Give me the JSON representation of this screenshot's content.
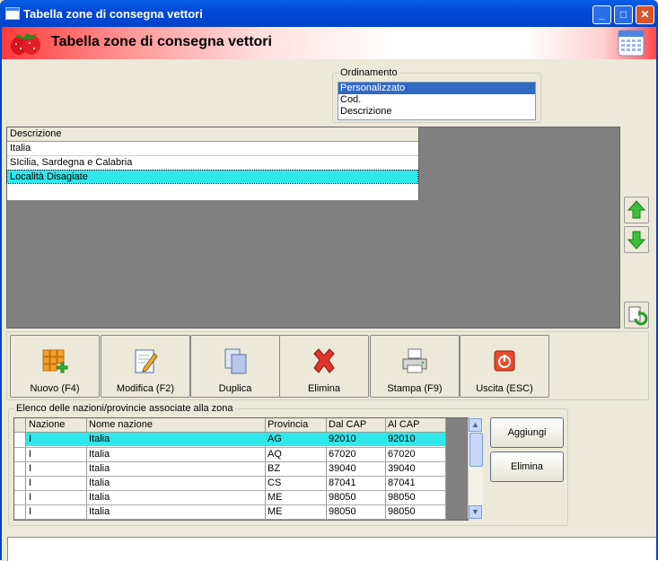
{
  "window": {
    "title": "Tabella zone di consegna vettori",
    "min": "_",
    "max": "□",
    "close": "✕"
  },
  "header": {
    "title": "Tabella zone di consegna vettori"
  },
  "ordinamento": {
    "label": "Ordinamento",
    "options": [
      "Personalizzato",
      "Cod.",
      "Descrizione"
    ],
    "selected": "Personalizzato"
  },
  "zones": {
    "column": "Descrizione",
    "rows": [
      "Italia",
      "SIcilia, Sardegna e Calabria",
      "Località Disagiate"
    ],
    "selected": "Località Disagiate"
  },
  "toolbar": {
    "nuovo": "Nuovo (F4)",
    "modifica": "Modifica (F2)",
    "duplica": "Duplica",
    "elimina": "Elimina",
    "stampa": "Stampa (F9)",
    "uscita": "Uscita (ESC)"
  },
  "nazioni": {
    "label": "Elenco delle nazioni/provincie associate alla zona",
    "columns": [
      "Nazione",
      "Nome nazione",
      "Provincia",
      "Dal CAP",
      "Al CAP"
    ],
    "rows": [
      [
        "I",
        "Italia",
        "AG",
        "92010",
        "92010"
      ],
      [
        "I",
        "Italia",
        "AQ",
        "67020",
        "67020"
      ],
      [
        "I",
        "Italia",
        "BZ",
        "39040",
        "39040"
      ],
      [
        "I",
        "Italia",
        "CS",
        "87041",
        "87041"
      ],
      [
        "I",
        "Italia",
        "ME",
        "98050",
        "98050"
      ],
      [
        "I",
        "Italia",
        "ME",
        "98050",
        "98050"
      ]
    ],
    "aggiungi": "Aggiungi",
    "elimina": "Elimina"
  },
  "icons": {
    "app": "strawberries-icon",
    "calendar": "calendar-icon",
    "up": "arrow-up-icon",
    "down": "arrow-down-icon",
    "refresh": "refresh-icon"
  }
}
